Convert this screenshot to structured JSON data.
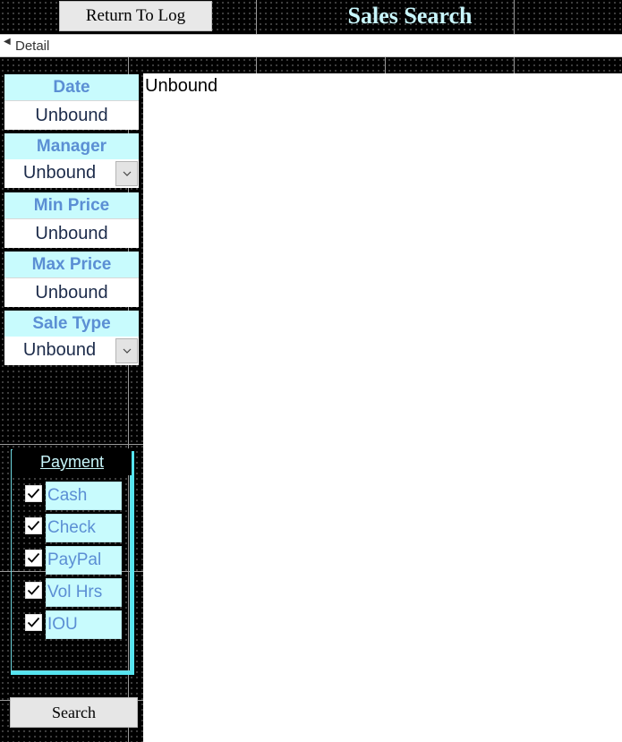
{
  "header": {
    "return_label": "Return To Log",
    "title": "Sales Search"
  },
  "detail_section": {
    "label": "Detail",
    "icon": "section-arrow-icon"
  },
  "filters": {
    "date": {
      "label": "Date",
      "value": "Unbound"
    },
    "manager": {
      "label": "Manager",
      "value": "Unbound"
    },
    "min_price": {
      "label": "Min Price",
      "value": "Unbound"
    },
    "max_price": {
      "label": "Max Price",
      "value": "Unbound"
    },
    "sale_type": {
      "label": "Sale Type",
      "value": "Unbound"
    }
  },
  "payment": {
    "title": "Payment",
    "options": [
      {
        "label": "Cash",
        "checked": true
      },
      {
        "label": "Check",
        "checked": true
      },
      {
        "label": "PayPal",
        "checked": true
      },
      {
        "label": "Vol Hrs",
        "checked": true
      },
      {
        "label": "IOU",
        "checked": true
      }
    ]
  },
  "search_label": "Search",
  "results_text": "Unbound",
  "colors": {
    "grid_bg": "#000000",
    "label_bg": "#c8fbfd",
    "label_text": "#5b8fd4",
    "title_text": "#c8f6fb",
    "frame_accent": "#56e4ef"
  }
}
